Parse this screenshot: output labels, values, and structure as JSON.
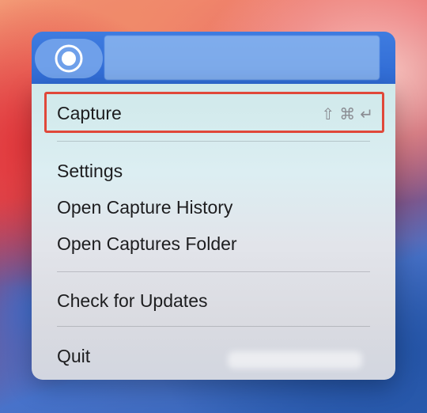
{
  "menubar": {
    "icon": "record-icon"
  },
  "menu": {
    "capture_label": "Capture",
    "shortcut": [
      "⇧",
      "⌘",
      "↵"
    ],
    "settings_label": "Settings",
    "history_label": "Open Capture History",
    "folder_label": "Open Captures Folder",
    "updates_label": "Check for Updates",
    "quit_label": "Quit"
  },
  "colors": {
    "highlight": "#e0483a",
    "menubar": "#3f7ce0"
  }
}
